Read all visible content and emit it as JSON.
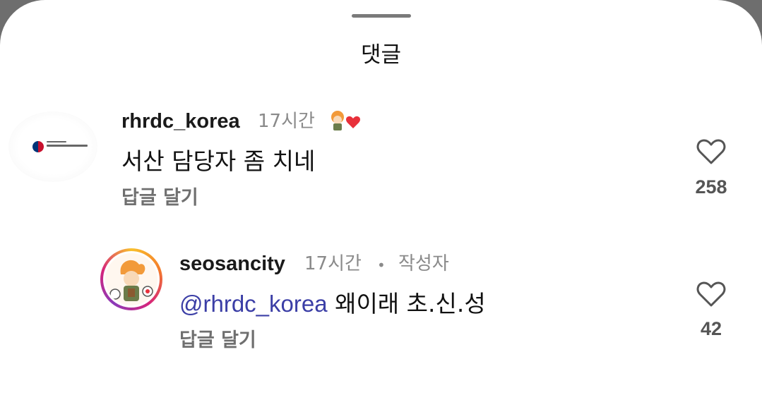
{
  "sheet": {
    "title": "댓글"
  },
  "comments": [
    {
      "username": "rhrdc_korea",
      "time": "17시간",
      "text": "서산 담당자 좀 치네",
      "reply_label": "답글 달기",
      "likes": "258"
    },
    {
      "username": "seosancity",
      "time": "17시간",
      "separator": "•",
      "author_badge": "작성자",
      "mention": "@rhrdc_korea",
      "text": " 왜이래 초.신.성",
      "reply_label": "답글 달기",
      "likes": "42"
    }
  ],
  "colors": {
    "mention": "#3b3ea6",
    "heart_sticker": "#e8303a"
  }
}
